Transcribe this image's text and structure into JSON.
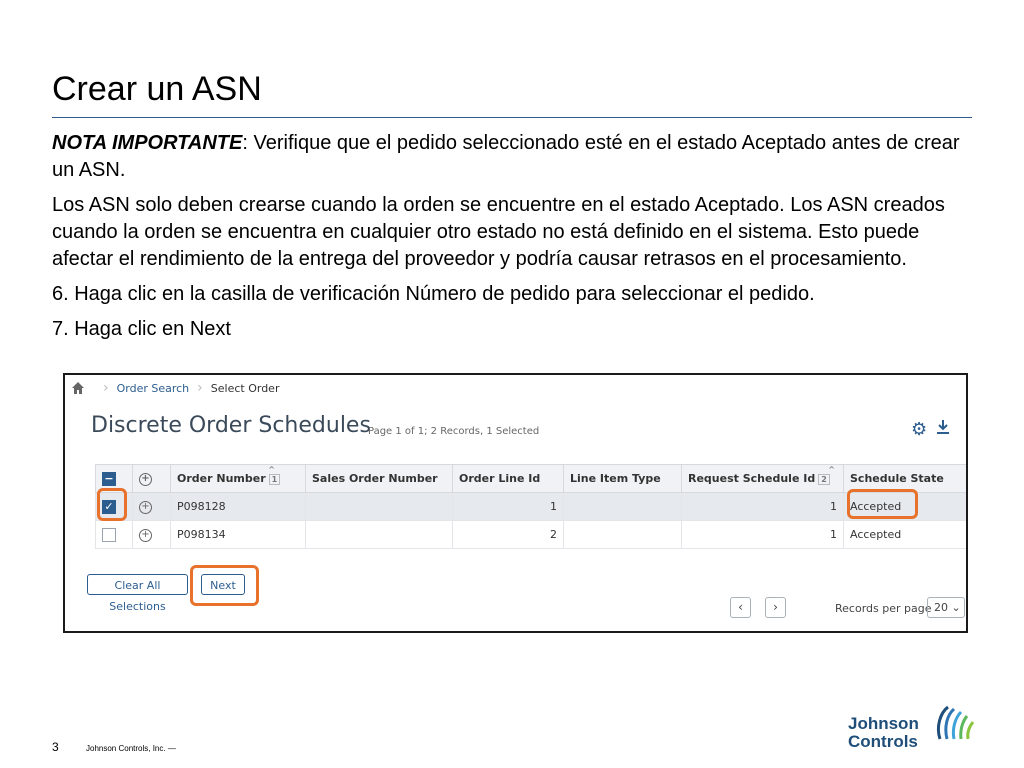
{
  "slide": {
    "title": "Crear un ASN",
    "note_bold": "NOTA IMPORTANTE",
    "note_rest": ": Verifique que el pedido seleccionado esté en el estado Aceptado antes de crear un ASN.",
    "para2": "Los ASN solo deben crearse cuando la orden se encuentre en el estado Aceptado. Los ASN creados cuando la orden se encuentra en cualquier otro estado no está definido en el sistema. Esto puede afectar el rendimiento de la entrega del proveedor y podría causar retrasos en el procesamiento.",
    "step6": "6. Haga clic en la casilla de verificación Número de pedido para seleccionar el pedido.",
    "step7": "7. Haga clic en Next",
    "page_number": "3",
    "footer": "Johnson Controls, Inc. —",
    "logo_line1": "Johnson",
    "logo_line2": "Controls"
  },
  "app": {
    "breadcrumb": {
      "home_icon": "home-icon",
      "order_search": "Order Search",
      "select_order": "Select Order"
    },
    "heading": "Discrete Order Schedules",
    "heading_meta": "Page 1 of 1; 2 Records, 1 Selected",
    "toolbar": {
      "settings_icon": "gear-icon",
      "download_icon": "download-icon"
    },
    "columns": {
      "order_number": "Order Number",
      "order_number_sort": "1",
      "sales_order_number": "Sales Order Number",
      "order_line_id": "Order Line Id",
      "line_item_type": "Line Item Type",
      "request_schedule_id": "Request Schedule Id",
      "request_schedule_sort": "2",
      "schedule_state": "Schedule State"
    },
    "rows": [
      {
        "order_number": "P098128",
        "sales_order_number": "",
        "order_line_id": "1",
        "line_item_type": "",
        "request_schedule_id": "1",
        "schedule_state": "Accepted",
        "selected": true
      },
      {
        "order_number": "P098134",
        "sales_order_number": "",
        "order_line_id": "2",
        "line_item_type": "",
        "request_schedule_id": "1",
        "schedule_state": "Accepted",
        "selected": false
      }
    ],
    "buttons": {
      "clear_all": "Clear All Selections",
      "next": "Next"
    },
    "pager": {
      "records_per_page_label": "Records per page",
      "records_per_page_value": "20"
    },
    "highlight_color": "#e8722b",
    "accent_color": "#2c5d8f"
  }
}
